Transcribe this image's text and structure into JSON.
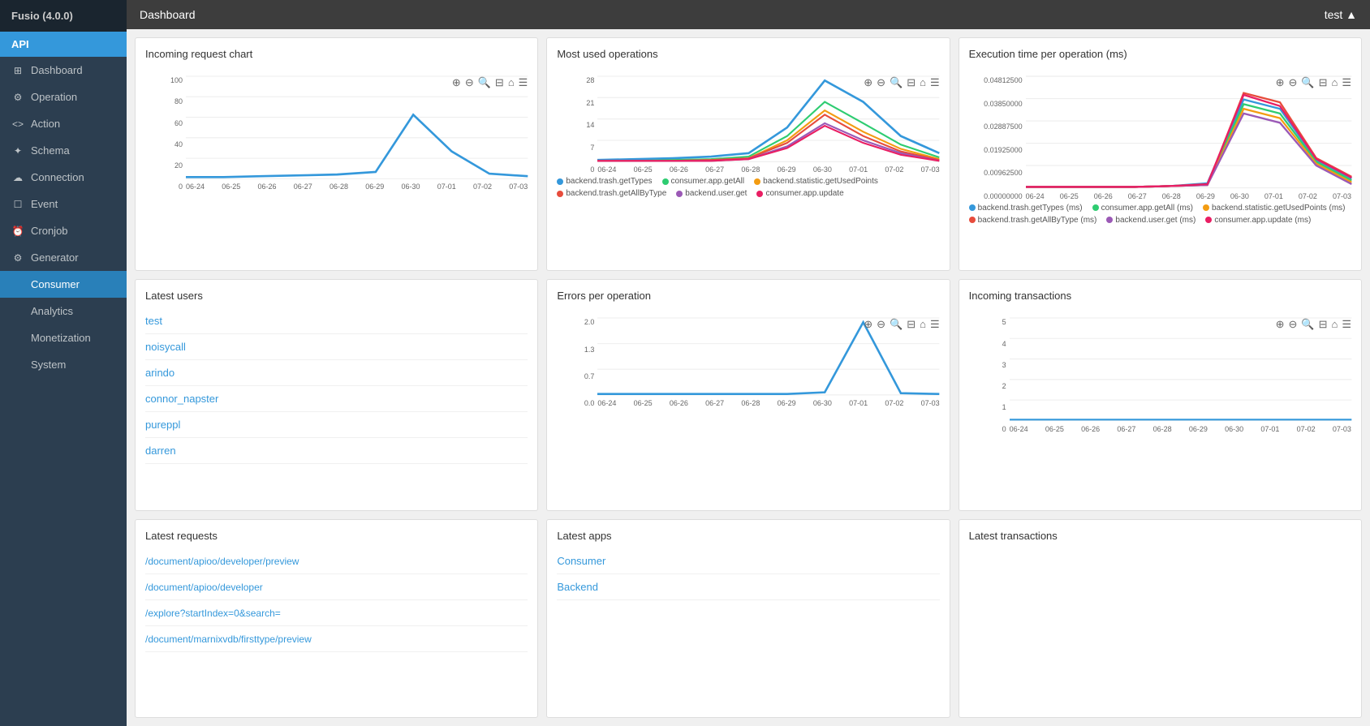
{
  "app": {
    "name": "Fusio",
    "version": "(4.0.0)"
  },
  "topbar": {
    "title": "Dashboard",
    "user": "test ▲"
  },
  "sidebar": {
    "api_label": "API",
    "items": [
      {
        "id": "dashboard",
        "label": "Dashboard",
        "icon": "⊞",
        "active": false
      },
      {
        "id": "operation",
        "label": "Operation",
        "icon": "⚙",
        "active": false
      },
      {
        "id": "action",
        "label": "Action",
        "icon": "<>",
        "active": false
      },
      {
        "id": "schema",
        "label": "Schema",
        "icon": "✦",
        "active": false
      },
      {
        "id": "connection",
        "label": "Connection",
        "icon": "☁",
        "active": false
      },
      {
        "id": "event",
        "label": "Event",
        "icon": "☐",
        "active": false
      },
      {
        "id": "cronjob",
        "label": "Cronjob",
        "icon": "⏰",
        "active": false
      },
      {
        "id": "generator",
        "label": "Generator",
        "icon": "⚙",
        "active": false
      },
      {
        "id": "consumer",
        "label": "Consumer",
        "icon": "",
        "active": true
      },
      {
        "id": "analytics",
        "label": "Analytics",
        "icon": "",
        "active": false
      },
      {
        "id": "monetization",
        "label": "Monetization",
        "icon": "",
        "active": false
      },
      {
        "id": "system",
        "label": "System",
        "icon": "",
        "active": false
      }
    ]
  },
  "panels": {
    "incoming_request_chart": {
      "title": "Incoming request chart",
      "y_labels": [
        "100",
        "80",
        "60",
        "40",
        "20",
        "0"
      ],
      "x_labels": [
        "06-24",
        "06-25",
        "06-26",
        "06-27",
        "06-28",
        "06-29",
        "06-30",
        "07-01",
        "07-02",
        "07-03"
      ]
    },
    "most_used_operations": {
      "title": "Most used operations",
      "y_labels": [
        "28",
        "21",
        "14",
        "7",
        "0"
      ],
      "x_labels": [
        "06-24",
        "06-25",
        "06-26",
        "06-27",
        "06-28",
        "06-29",
        "06-30",
        "07-01",
        "07-02",
        "07-03"
      ],
      "legend": [
        {
          "color": "#3498db",
          "label": "backend.trash.getTypes"
        },
        {
          "color": "#2ecc71",
          "label": "consumer.app.getAll"
        },
        {
          "color": "#f39c12",
          "label": "backend.statistic.getUsedPoints"
        },
        {
          "color": "#e74c3c",
          "label": "backend.trash.getAllByType"
        },
        {
          "color": "#9b59b6",
          "label": "backend.user.get"
        },
        {
          "color": "#e91e63",
          "label": "consumer.app.update"
        }
      ]
    },
    "execution_time": {
      "title": "Execution time per operation (ms)",
      "y_labels": [
        "0.04812500",
        "0.03850000",
        "0.02887500",
        "0.01925000",
        "0.00962500",
        "0.00000000"
      ],
      "x_labels": [
        "06-24",
        "06-25",
        "06-26",
        "06-27",
        "06-28",
        "06-29",
        "06-30",
        "07-01",
        "07-02",
        "07-03"
      ],
      "legend": [
        {
          "color": "#3498db",
          "label": "backend.trash.getTypes (ms)"
        },
        {
          "color": "#2ecc71",
          "label": "consumer.app.getAll (ms)"
        },
        {
          "color": "#f39c12",
          "label": "backend.statistic.getUsedPoints (ms)"
        },
        {
          "color": "#e74c3c",
          "label": "backend.trash.getAllByType (ms)"
        },
        {
          "color": "#9b59b6",
          "label": "backend.user.get (ms)"
        },
        {
          "color": "#e91e63",
          "label": "consumer.app.update (ms)"
        }
      ]
    },
    "latest_users": {
      "title": "Latest users",
      "users": [
        "test",
        "noisycall",
        "arindo",
        "connor_napster",
        "pureppl",
        "darren"
      ]
    },
    "errors_per_operation": {
      "title": "Errors per operation",
      "y_labels": [
        "2.0",
        "1.3",
        "0.7",
        "0.0"
      ],
      "x_labels": [
        "06-24",
        "06-25",
        "06-26",
        "06-27",
        "06-28",
        "06-29",
        "06-30",
        "07-01",
        "07-02",
        "07-03"
      ]
    },
    "incoming_transactions": {
      "title": "Incoming transactions",
      "y_labels": [
        "5",
        "4",
        "3",
        "2",
        "1",
        "0"
      ],
      "x_labels": [
        "06-24",
        "06-25",
        "06-26",
        "06-27",
        "06-28",
        "06-29",
        "06-30",
        "07-01",
        "07-02",
        "07-03"
      ]
    },
    "latest_requests": {
      "title": "Latest requests",
      "requests": [
        "/document/apioo/developer/preview",
        "/document/apioo/developer",
        "/explore?startIndex=0&search=",
        "/document/marnixvdb/firsttype/preview"
      ]
    },
    "latest_apps": {
      "title": "Latest apps",
      "apps": [
        "Consumer",
        "Backend"
      ]
    },
    "latest_transactions": {
      "title": "Latest transactions"
    }
  },
  "chart_icons": "⊕ ⊖ 🔍 🖨 ⌂ ☰"
}
